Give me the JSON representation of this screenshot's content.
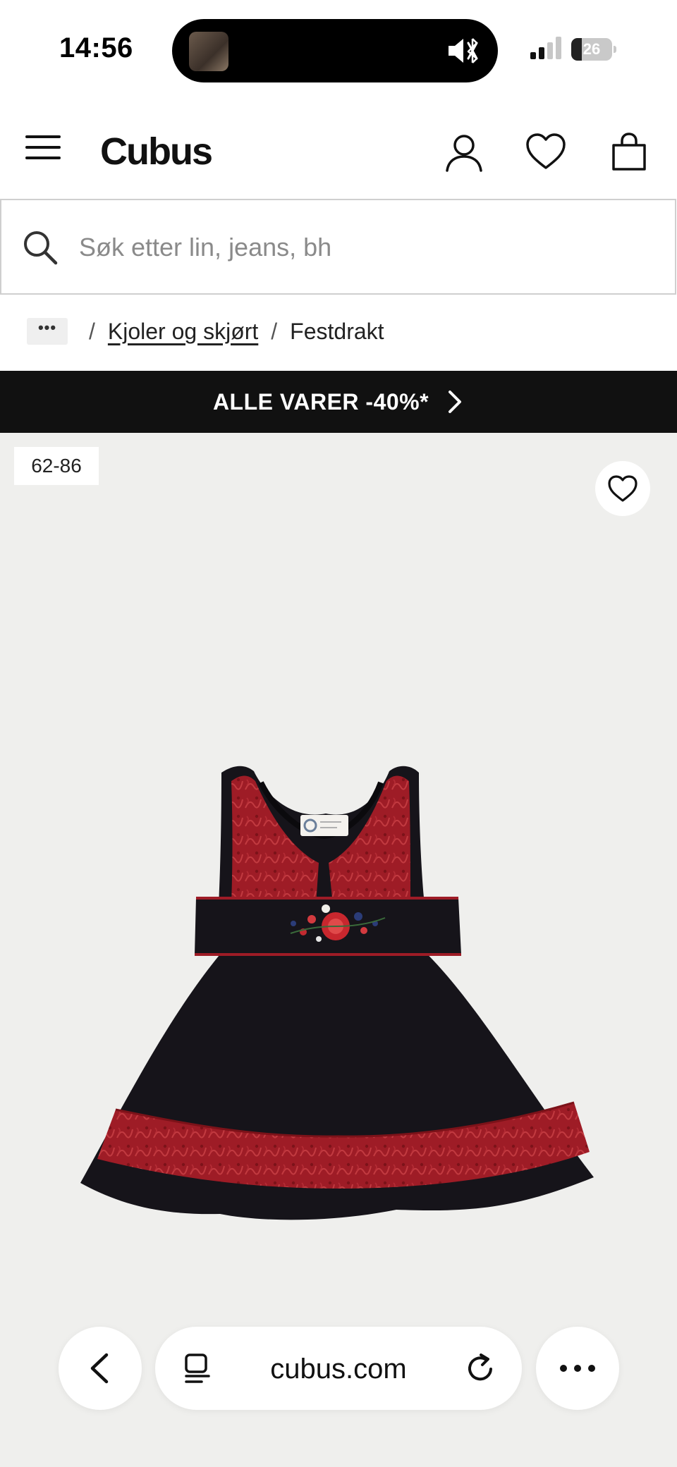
{
  "status_bar": {
    "time": "14:56",
    "battery": "26",
    "battery_level": 0.26
  },
  "header": {
    "logo": "Cubus"
  },
  "search": {
    "placeholder": "Søk etter lin, jeans, bh",
    "value": ""
  },
  "breadcrumb": {
    "more_label": "•••",
    "items": [
      {
        "label": "Kjoler og skjørt"
      },
      {
        "label": "Festdrakt"
      }
    ],
    "separator": "/"
  },
  "promo": {
    "label": "ALLE VARER -40%*"
  },
  "product": {
    "size_badge": "62-86"
  },
  "browser_bar": {
    "url": "cubus.com"
  },
  "colors": {
    "promo_background": "#111111",
    "product_background": "#efefed",
    "dress_black": "#15131a",
    "dress_red": "#9e1c26"
  },
  "icons": {
    "menu": "hamburger-icon",
    "account": "user-icon",
    "wishlist": "heart-icon",
    "bag": "bag-icon",
    "search": "search-icon",
    "promo": "chevron-right-icon",
    "back": "chevron-left-icon",
    "tabs": "tabs-icon",
    "reload": "reload-icon",
    "more": "more-dots-icon"
  }
}
